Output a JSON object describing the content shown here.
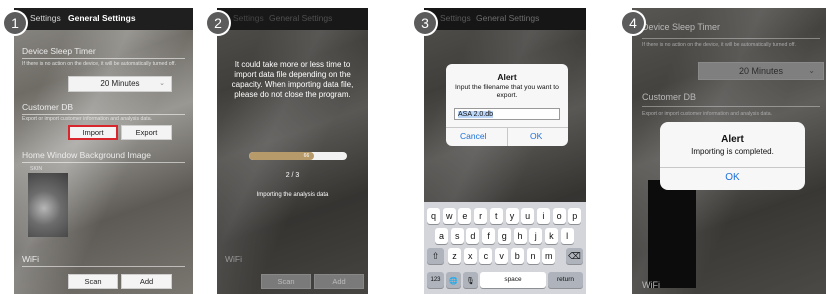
{
  "steps": [
    "1",
    "2",
    "3",
    "4"
  ],
  "nav": {
    "settings": "Settings",
    "general_settings": "General Settings"
  },
  "panel1": {
    "device_sleep_timer": "Device Sleep Timer",
    "sleep_note": "If there is no action on the device, it will be automatically turned off.",
    "minutes_value": "20 Minutes",
    "customer_db": "Customer DB",
    "export_note": "Export or import customer information and analysis data.",
    "import_label": "Import",
    "export_label": "Export",
    "home_bg": "Home Window Background Image",
    "skin_label": "SKIN",
    "wifi": "WiFi",
    "scan_label": "Scan",
    "add_label": "Add"
  },
  "panel2": {
    "warning": "It could take more or less time to import data file depending on the capacity. When importing data file, please do not close the program.",
    "progress_percent": "66",
    "progress_fraction": 0.66,
    "progress_count": "2 / 3",
    "importing_text": "Importing the analysis data",
    "scan_label": "Scan",
    "add_label": "Add",
    "wifi": "WiFi"
  },
  "panel3": {
    "alert_title": "Alert",
    "alert_message": "Input the filename that you want to export.",
    "filename_value": "ASA 2.0.db",
    "cancel_label": "Cancel",
    "ok_label": "OK",
    "keyboard_rows": [
      [
        "q",
        "w",
        "e",
        "r",
        "t",
        "y",
        "u",
        "i",
        "o",
        "p"
      ],
      [
        "a",
        "s",
        "d",
        "f",
        "g",
        "h",
        "j",
        "k",
        "l"
      ],
      [
        "z",
        "x",
        "c",
        "v",
        "b",
        "n",
        "m"
      ]
    ],
    "numbers_key": "123",
    "space_key": "space",
    "return_key": "return",
    "shift_key": "⇧",
    "backspace_key": "⌫",
    "globe_key": "🌐",
    "mic_key": "🎙"
  },
  "panel4": {
    "device_sleep_timer": "Device Sleep Timer",
    "sleep_note": "If there is no action on the device, it will be automatically turned off.",
    "minutes_value": "20 Minutes",
    "customer_db": "Customer DB",
    "export_note": "Export or import customer information and analysis data.",
    "alert_title": "Alert",
    "alert_message": "Importing is completed.",
    "ok_label": "OK",
    "wifi": "WiFi"
  },
  "colors": {
    "highlight_red": "#d8262c",
    "ios_blue": "#1e6fd9"
  }
}
